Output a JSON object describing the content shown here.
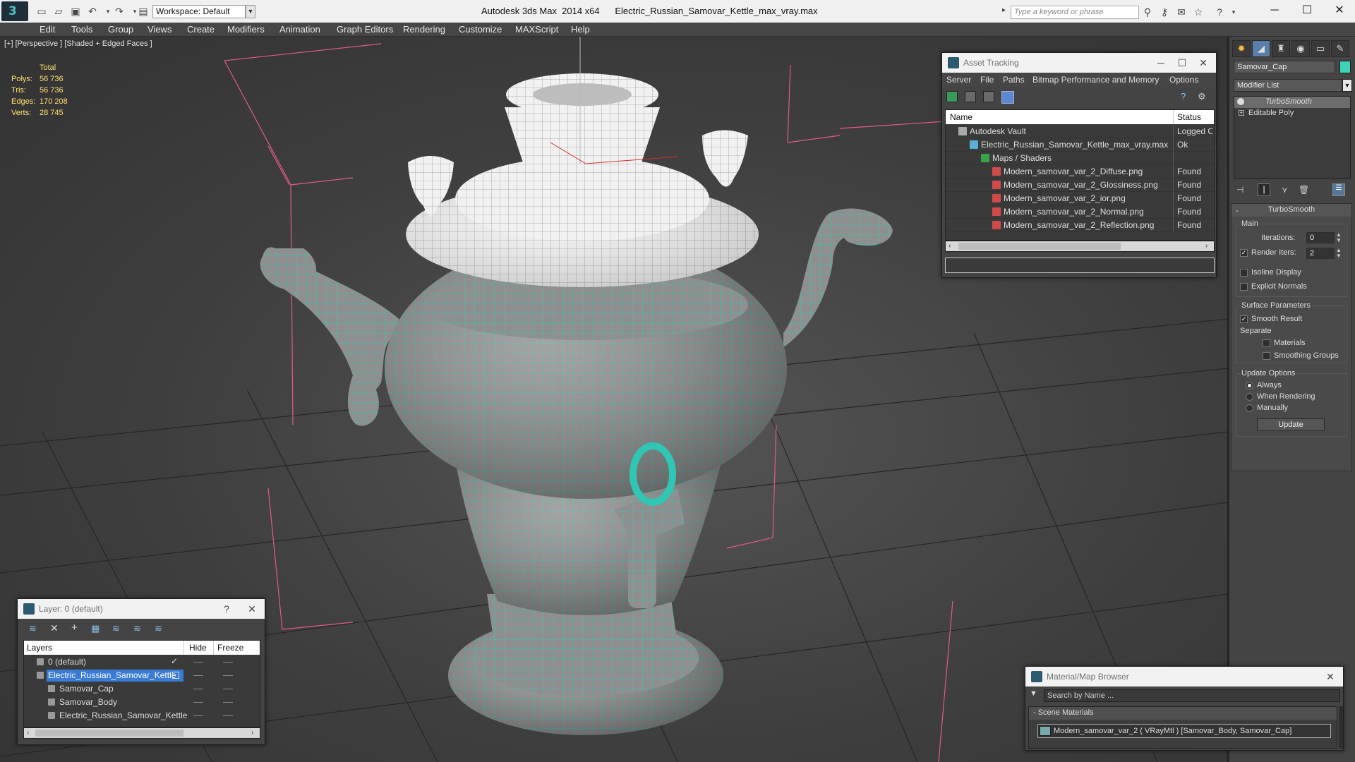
{
  "titlebar": {
    "workspace": "Workspace: Default",
    "app_title": "Autodesk 3ds Max  2014 x64",
    "file_title": "Electric_Russian_Samovar_Kettle_max_vray.max",
    "search_placeholder": "Type a keyword or phrase"
  },
  "menu": [
    "Edit",
    "Tools",
    "Group",
    "Views",
    "Create",
    "Modifiers",
    "Animation",
    "Graph Editors",
    "Rendering",
    "Customize",
    "MAXScript",
    "Help"
  ],
  "viewport": {
    "label": "[+] [Perspective ] [Shaded + Edged Faces ]",
    "stats_header": "Total",
    "stats": [
      {
        "label": "Polys:",
        "value": "56 736"
      },
      {
        "label": "Tris:",
        "value": "56 736"
      },
      {
        "label": "Edges:",
        "value": "170 208"
      },
      {
        "label": "Verts:",
        "value": "28 745"
      }
    ]
  },
  "asset_tracking": {
    "title": "Asset Tracking",
    "menu": [
      "Server",
      "File",
      "Paths",
      "Bitmap Performance and Memory",
      "Options"
    ],
    "col_name": "Name",
    "col_status": "Status",
    "rows": [
      {
        "name": "Autodesk Vault",
        "status": "Logged O",
        "indent": 0
      },
      {
        "name": "Electric_Russian_Samovar_Kettle_max_vray.max",
        "status": "Ok",
        "indent": 1
      },
      {
        "name": "Maps / Shaders",
        "status": "",
        "indent": 2
      },
      {
        "name": "Modern_samovar_var_2_Diffuse.png",
        "status": "Found",
        "indent": 3
      },
      {
        "name": "Modern_samovar_var_2_Glossiness.png",
        "status": "Found",
        "indent": 3
      },
      {
        "name": "Modern_samovar_var_2_ior.png",
        "status": "Found",
        "indent": 3
      },
      {
        "name": "Modern_samovar_var_2_Normal.png",
        "status": "Found",
        "indent": 3
      },
      {
        "name": "Modern_samovar_var_2_Reflection.png",
        "status": "Found",
        "indent": 3
      }
    ]
  },
  "layer_dialog": {
    "title": "Layer: 0 (default)",
    "help": "?",
    "col_layers": "Layers",
    "col_hide": "Hide",
    "col_freeze": "Freeze",
    "rows": [
      {
        "name": "0 (default)",
        "indent": 0,
        "selected": false
      },
      {
        "name": "Electric_Russian_Samovar_Kettle",
        "indent": 0,
        "selected": true
      },
      {
        "name": "Samovar_Cap",
        "indent": 1,
        "selected": false
      },
      {
        "name": "Samovar_Body",
        "indent": 1,
        "selected": false
      },
      {
        "name": "Electric_Russian_Samovar_Kettle",
        "indent": 1,
        "selected": false
      }
    ]
  },
  "material_browser": {
    "title": "Material/Map Browser",
    "search_placeholder": "Search by Name ...",
    "section": "- Scene Materials",
    "item": "Modern_samovar_var_2  ( VRayMtl ) [Samovar_Body, Samovar_Cap]"
  },
  "command_panel": {
    "object_name": "Samovar_Cap",
    "object_color": "#3ed3b8",
    "modifier_list": "Modifier List",
    "stack": [
      "TurboSmooth",
      "Editable Poly"
    ],
    "rollout_title": "TurboSmooth",
    "main_label": "Main",
    "iterations_label": "Iterations:",
    "iterations_value": "0",
    "render_iters_label": "Render Iters:",
    "render_iters_value": "2",
    "isoline": "Isoline Display",
    "explicit_normals": "Explicit Normals",
    "surface_params": "Surface Parameters",
    "smooth_result": "Smooth Result",
    "separate": "Separate",
    "materials": "Materials",
    "smoothing_groups": "Smoothing Groups",
    "update_options": "Update Options",
    "always": "Always",
    "when_rendering": "When Rendering",
    "manually": "Manually",
    "update_btn": "Update"
  },
  "colors": {
    "wire": "#2fc7b3",
    "mesh_fill": "#8f8f8f",
    "selection": "#3a7bd5",
    "stats": "#ffe070"
  }
}
